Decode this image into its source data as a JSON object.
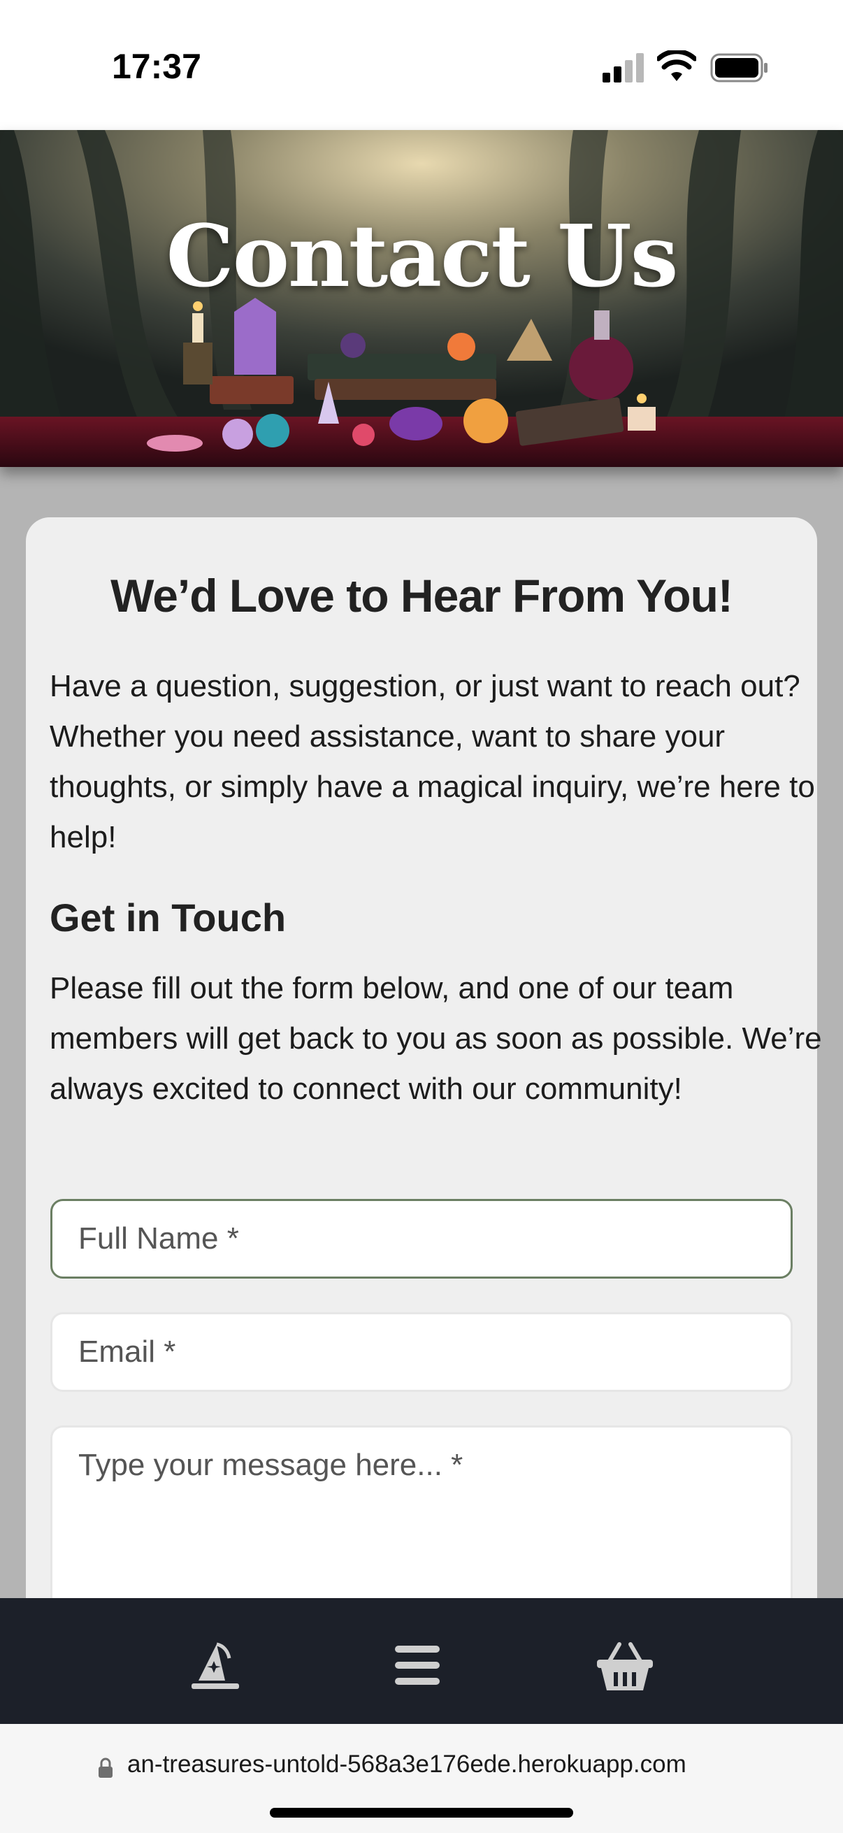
{
  "status_bar": {
    "time": "17:37",
    "icons": [
      "cellular-signal-icon",
      "wifi-icon",
      "battery-icon"
    ]
  },
  "hero": {
    "title": "Contact Us",
    "image": "mystical-crystals-potions-forest-banner"
  },
  "card": {
    "heading": "We’d Love to Hear From You!",
    "intro": "Have a question, suggestion, or just want to reach out? Whether you need assistance, want to share your thoughts, or simply have a magical inquiry, we’re here to help!",
    "subheading": "Get in Touch",
    "touch_text": "Please fill out the form below, and one of our team members will get back to you as soon as possible. We’re always excited to connect with our community!"
  },
  "form": {
    "full_name_placeholder": "Full Name *",
    "email_placeholder": "Email *",
    "message_placeholder": "Type your message here... *"
  },
  "bottom_nav": {
    "items": [
      {
        "icon": "wizard-hat-icon"
      },
      {
        "icon": "hamburger-menu-icon"
      },
      {
        "icon": "basket-icon"
      }
    ]
  },
  "browser": {
    "url": "an-treasures-untold-568a3e176ede.herokuapp.com"
  },
  "colors": {
    "page_bg": "#b4b4b4",
    "card_bg": "#efefef",
    "nav_bg": "#1c2029",
    "focused_border": "#6b7f63"
  }
}
